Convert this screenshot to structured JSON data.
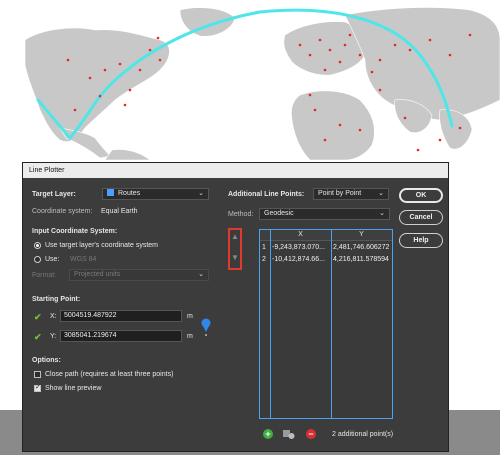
{
  "window": {
    "title": "Line Plotter"
  },
  "target_layer": {
    "label": "Target Layer:",
    "value": "Routes",
    "coord_label": "Coordinate system:",
    "coord_value": "Equal Earth"
  },
  "input_cs": {
    "heading": "Input Coordinate System:",
    "option_target": "Use target layer's coordinate system",
    "option_use": "Use:",
    "use_value": "WGS 84",
    "format_label": "Format:",
    "format_value": "Projected units"
  },
  "starting_point": {
    "heading": "Starting Point:",
    "x_label": "X:",
    "x_value": "5004519.487922",
    "y_label": "Y:",
    "y_value": "3085041.219674",
    "unit": "m"
  },
  "options": {
    "heading": "Options:",
    "close_path": "Close path (requires at least three points)",
    "close_path_checked": false,
    "show_preview": "Show line preview",
    "show_preview_checked": true
  },
  "additional": {
    "label": "Additional Line Points:",
    "mode": "Point by Point",
    "method_label": "Method:",
    "method_value": "Geodesic"
  },
  "table": {
    "columns": [
      "X",
      "Y"
    ],
    "rows": [
      {
        "index": "1",
        "x": "-9,243,873.070...",
        "y": "2,481,746.606272"
      },
      {
        "index": "2",
        "x": "-10,412,874.66...",
        "y": "4,216,811.578594"
      }
    ]
  },
  "footer": {
    "status": "2 additional point(s)"
  },
  "buttons": {
    "ok": "OK",
    "cancel": "Cancel",
    "help": "Help"
  },
  "colors": {
    "route": "#4fe6ea",
    "dot": "#e02a2a",
    "accent": "#4aa3f0",
    "highlight": "#e03a2f",
    "land": "#c8c8c8"
  },
  "icons": {
    "add": "plus-icon",
    "edit": "edit-points-icon",
    "remove": "minus-icon",
    "pin": "location-pin-icon"
  }
}
